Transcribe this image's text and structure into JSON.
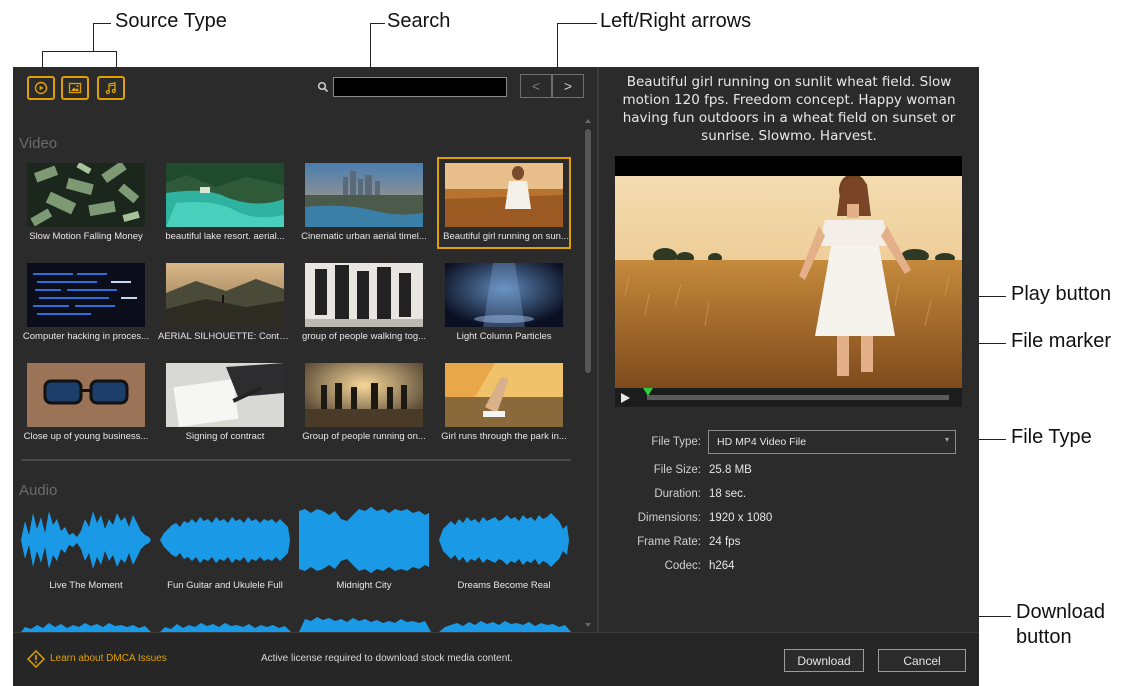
{
  "callouts": {
    "source_type": "Source Type",
    "search": "Search",
    "arrows": "Left/Right arrows",
    "play": "Play button",
    "marker": "File marker",
    "file_type": "File Type",
    "download_line1": "Download",
    "download_line2": "button"
  },
  "toolbar": {
    "source_buttons": [
      {
        "icon": "video-icon"
      },
      {
        "icon": "image-icon"
      },
      {
        "icon": "music-icon"
      }
    ],
    "search_value": "",
    "prev_label": "<",
    "next_label": ">"
  },
  "sections": {
    "video_title": "Video",
    "audio_title": "Audio"
  },
  "videos": [
    {
      "label": "Slow Motion Falling Money"
    },
    {
      "label": "beautiful lake resort. aerial..."
    },
    {
      "label": "Cinematic urban aerial timel..."
    },
    {
      "label": "Beautiful girl running on sun...",
      "selected": true
    },
    {
      "label": "Computer hacking in proces..."
    },
    {
      "label": "AERIAL SILHOUETTE: Conto..."
    },
    {
      "label": "group of people walking tog..."
    },
    {
      "label": "Light Column Particles"
    },
    {
      "label": "Close up of young business..."
    },
    {
      "label": "Signing of contract"
    },
    {
      "label": "Group of people running on..."
    },
    {
      "label": "Girl runs through the park in..."
    }
  ],
  "audio": [
    {
      "label": "Live The Moment"
    },
    {
      "label": "Fun Guitar and Ukulele Full"
    },
    {
      "label": "Midnight City"
    },
    {
      "label": "Dreams Become Real"
    }
  ],
  "detail": {
    "description": "Beautiful girl running on sunlit wheat field. Slow motion 120 fps. Freedom concept. Happy woman having fun outdoors in a wheat field on sunset or sunrise. Slowmo. Harvest.",
    "file_type_label": "File Type:",
    "file_type_value": "HD MP4 Video File",
    "file_size_label": "File Size:",
    "file_size_value": "25.8 MB",
    "duration_label": "Duration:",
    "duration_value": "18 sec.",
    "dimensions_label": "Dimensions:",
    "dimensions_value": "1920 x 1080",
    "frame_rate_label": "Frame Rate:",
    "frame_rate_value": "24 fps",
    "codec_label": "Codec:",
    "codec_value": "h264"
  },
  "footer": {
    "dmca_link": "Learn about DMCA Issues",
    "license_notice": "Active license required to download stock media content.",
    "download_label": "Download",
    "cancel_label": "Cancel"
  },
  "colors": {
    "accent": "#e0a000",
    "panel_bg": "#2b2b2b",
    "waveform": "#1a9ae6",
    "marker": "#2ecc40"
  }
}
